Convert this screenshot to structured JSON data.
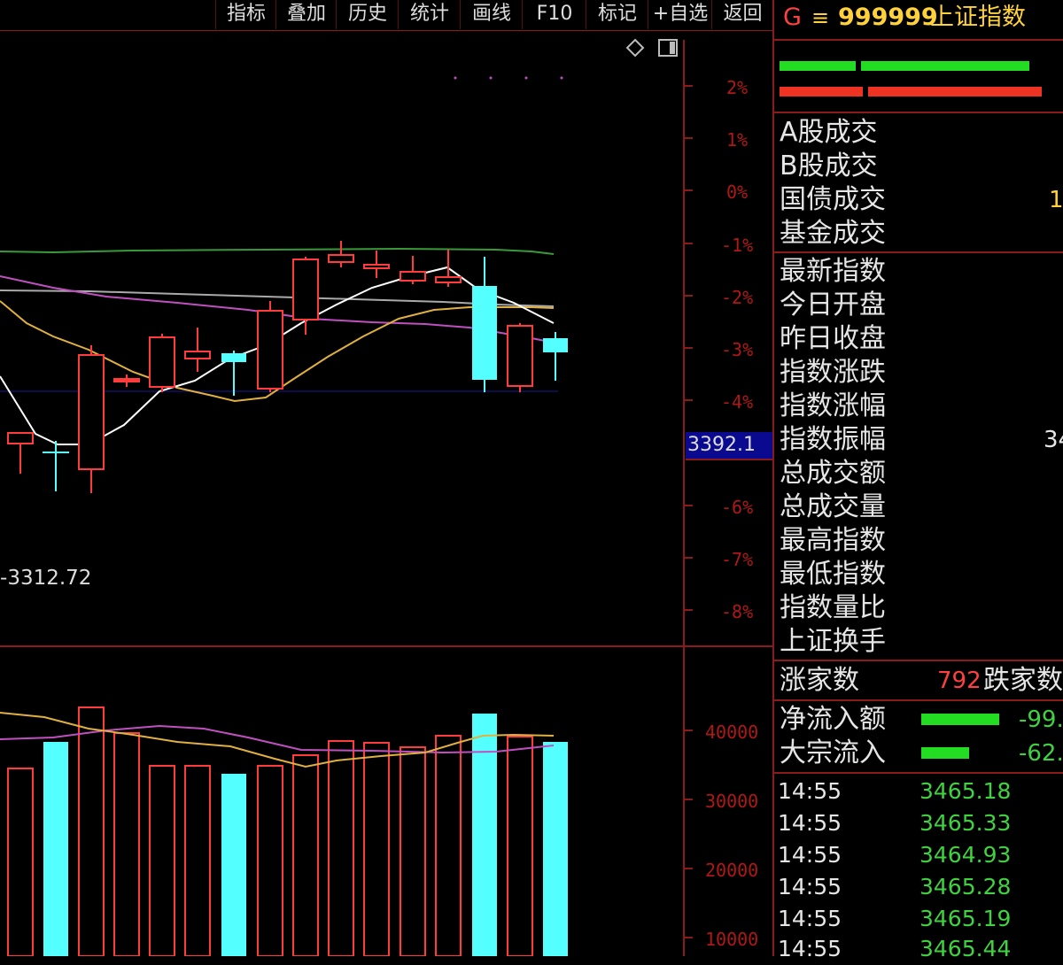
{
  "toolbar": {
    "items": [
      "指标",
      "叠加",
      "历史",
      "统计",
      "画线",
      "F10",
      "标记",
      "+自选",
      "返回"
    ]
  },
  "header": {
    "g_label": "G",
    "menu_glyph": "≡",
    "code": "999999",
    "name": "上证指数"
  },
  "trade_labels": [
    "A股成交",
    "B股成交",
    "国债成交",
    "基金成交"
  ],
  "trade_partial_value": "1",
  "index_labels": [
    "最新指数",
    "今日开盘",
    "昨日收盘",
    "指数涨跌",
    "指数涨幅",
    "指数振幅",
    "总成交额",
    "总成交量",
    "最高指数",
    "最低指数",
    "指数量比",
    "上证换手"
  ],
  "amplitude_partial_value": "34",
  "breadth": {
    "up_label": "涨家数",
    "up_count": "792",
    "down_label": "跌家数"
  },
  "flows": [
    {
      "label": "净流入额",
      "value": "-99."
    },
    {
      "label": "大宗流入",
      "value": "-62."
    }
  ],
  "ticks": [
    {
      "time": "14:55",
      "price": "3465.18"
    },
    {
      "time": "14:55",
      "price": "3465.33"
    },
    {
      "time": "14:55",
      "price": "3464.93"
    },
    {
      "time": "14:55",
      "price": "3465.28"
    },
    {
      "time": "14:55",
      "price": "3465.19"
    },
    {
      "time": "14:55",
      "price": "3465.44"
    }
  ],
  "chart_data": {
    "type": "candlestick",
    "price_axis_labels": [
      "2%",
      "1%",
      "0%",
      "-1%",
      "-2%",
      "-3%",
      "-4%",
      "-6%",
      "-7%",
      "-8%"
    ],
    "cursor_price": "3392.1",
    "low_marker": "3312.72",
    "volume_axis_labels": [
      "40000",
      "30000",
      "20000",
      "10000"
    ],
    "colors": {
      "up": "#ff3b3b",
      "down": "#54ffff",
      "ma_white": "#ffffff",
      "ma_yellow": "#e0b040",
      "ma_purple": "#c050c0",
      "ma_green": "#3a9a3a"
    }
  }
}
